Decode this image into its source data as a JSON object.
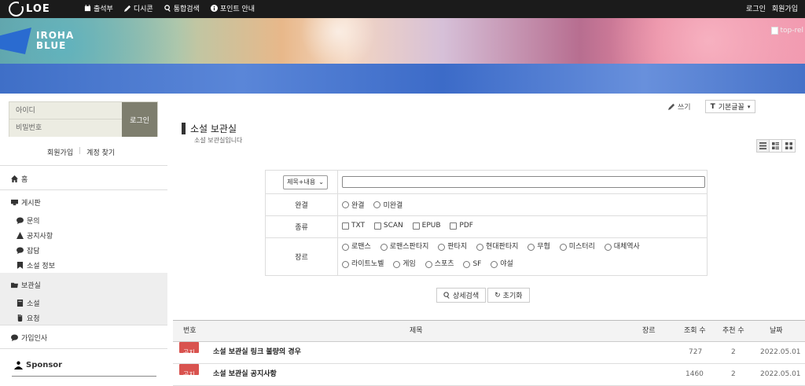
{
  "topbar": {
    "logo": "LOE",
    "nav": [
      {
        "label": "출석부",
        "icon": "calendar-icon"
      },
      {
        "label": "디시콘",
        "icon": "pencil-icon"
      },
      {
        "label": "통합검색",
        "icon": "search-icon"
      },
      {
        "label": "포인트 안내",
        "icon": "info-circle-icon"
      }
    ],
    "right": [
      "로그인",
      "회원가입"
    ]
  },
  "banner": {
    "brand_line1": "IROHA",
    "brand_line2": "BLUE",
    "broken_img_alt": "top-rel"
  },
  "sidebar": {
    "login": {
      "id_placeholder": "아이디",
      "pw_placeholder": "비밀번호",
      "button": "로그인"
    },
    "join": "회원가입",
    "find": "계정 찾기",
    "menu": {
      "home": "홈",
      "board": "게시판",
      "board_items": [
        "문의",
        "공지사항",
        "잡담",
        "소설 정보"
      ],
      "archive": "보관실",
      "archive_items": [
        "소설",
        "요청"
      ],
      "greeting": "가입인사"
    },
    "sponsor": "Sponsor"
  },
  "main": {
    "write": "쓰기",
    "font": "기본글꼴",
    "title": "소설 보관실",
    "subtitle": "소설 보관실입니다",
    "search": {
      "select_value": "제목+내용",
      "completion_label": "완결",
      "completion_options": [
        "완결",
        "미완결"
      ],
      "type_label": "종류",
      "type_options": [
        "TXT",
        "SCAN",
        "EPUB",
        "PDF"
      ],
      "genre_label": "장르",
      "genre_options_row1": [
        "로맨스",
        "로맨스판타지",
        "판타지",
        "현대판타지",
        "무협",
        "미스터리",
        "대체역사"
      ],
      "genre_options_row2": [
        "라이트노벨",
        "게임",
        "스포츠",
        "SF",
        "야설"
      ]
    },
    "buttons": {
      "search": "상세검색",
      "reset": "초기화"
    },
    "list": {
      "headers": [
        "번호",
        "제목",
        "장르",
        "조회 수",
        "추천 수",
        "날짜"
      ],
      "rows": [
        {
          "badge": "공지",
          "title": "소설 보관실 링크 불량의 경우",
          "genre": "",
          "views": "727",
          "likes": "2",
          "date": "2022.05.01"
        },
        {
          "badge": "공지",
          "title": "소설 보관실 공지사항",
          "genre": "",
          "views": "1460",
          "likes": "2",
          "date": "2022.05.01"
        }
      ]
    }
  }
}
